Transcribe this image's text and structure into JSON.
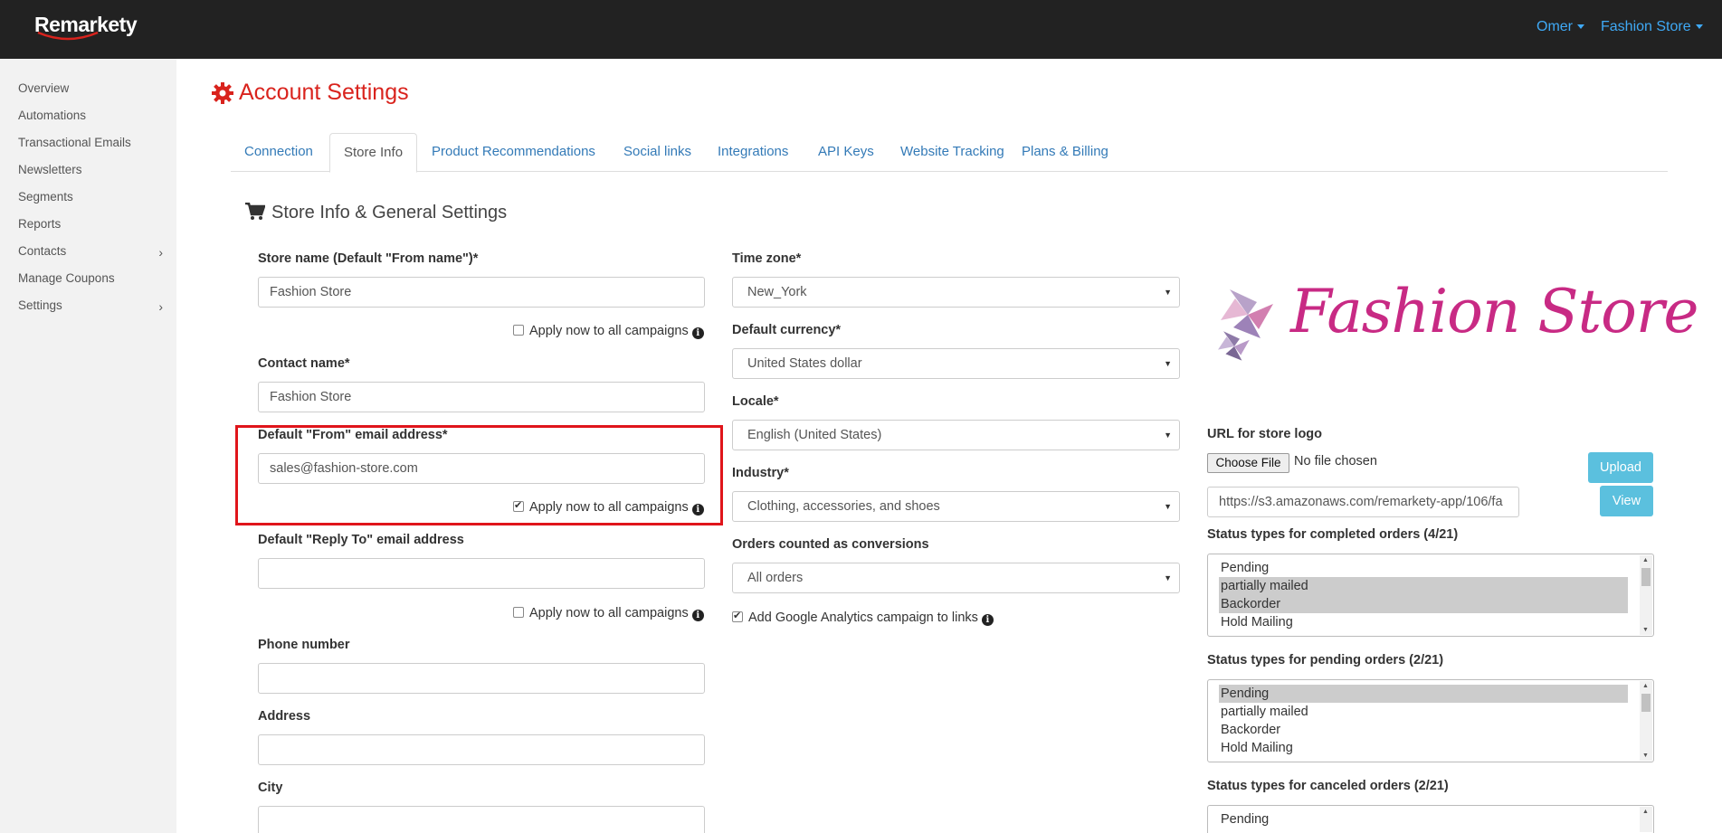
{
  "app": {
    "logo": "Remarkety"
  },
  "topnav": {
    "user": "Omer",
    "store": "Fashion Store"
  },
  "sidebar": {
    "items": [
      {
        "label": "Overview"
      },
      {
        "label": "Automations"
      },
      {
        "label": "Transactional Emails"
      },
      {
        "label": "Newsletters"
      },
      {
        "label": "Segments"
      },
      {
        "label": "Reports"
      },
      {
        "label": "Contacts",
        "has_submenu": true
      },
      {
        "label": "Manage Coupons"
      },
      {
        "label": "Settings",
        "has_submenu": true
      }
    ]
  },
  "page": {
    "title": "Account Settings"
  },
  "tabs": [
    {
      "label": "Connection"
    },
    {
      "label": "Store Info",
      "active": true
    },
    {
      "label": "Product Recommendations"
    },
    {
      "label": "Social links"
    },
    {
      "label": "Integrations"
    },
    {
      "label": "API Keys"
    },
    {
      "label": "Website Tracking"
    },
    {
      "label": "Plans & Billing"
    }
  ],
  "section": {
    "title": "Store Info & General Settings"
  },
  "left": {
    "store_name": {
      "label": "Store name (Default \"From name\")*",
      "value": "Fashion Store",
      "apply_checked": false
    },
    "contact_name": {
      "label": "Contact name*",
      "value": "Fashion Store"
    },
    "from_email": {
      "label": "Default \"From\" email address*",
      "value": "sales@fashion-store.com",
      "apply_checked": true
    },
    "reply_to": {
      "label": "Default \"Reply To\" email address",
      "value": "",
      "apply_checked": false
    },
    "phone": {
      "label": "Phone number",
      "value": ""
    },
    "address": {
      "label": "Address",
      "value": ""
    },
    "city": {
      "label": "City",
      "value": ""
    },
    "apply_label": "Apply now to all campaigns"
  },
  "middle": {
    "timezone": {
      "label": "Time zone*",
      "value": "New_York"
    },
    "currency": {
      "label": "Default currency*",
      "value": "United States dollar"
    },
    "locale": {
      "label": "Locale*",
      "value": "English (United States)"
    },
    "industry": {
      "label": "Industry*",
      "value": "Clothing, accessories, and shoes"
    },
    "conversions": {
      "label": "Orders counted as conversions",
      "value": "All orders"
    },
    "ga_checkbox": {
      "label": "Add Google Analytics campaign to links",
      "checked": true
    }
  },
  "right": {
    "logo_text": "Fashion Store",
    "logo_url_label": "URL for store logo",
    "choose_file": "Choose File",
    "no_file": "No file chosen",
    "upload_button": "Upload",
    "view_button": "View",
    "logo_url_value": "https://s3.amazonaws.com/remarkety-app/106/fa",
    "completed": {
      "label": "Status types for completed orders (4/21)",
      "options": [
        {
          "label": "Pending",
          "selected": false
        },
        {
          "label": "partially mailed",
          "selected": true
        },
        {
          "label": "Backorder",
          "selected": true
        },
        {
          "label": "Hold Mailing",
          "selected": false
        }
      ]
    },
    "pending": {
      "label": "Status types for pending orders (2/21)",
      "options": [
        {
          "label": "Pending",
          "selected": true
        },
        {
          "label": "partially mailed",
          "selected": false
        },
        {
          "label": "Backorder",
          "selected": false
        },
        {
          "label": "Hold Mailing",
          "selected": false
        }
      ]
    },
    "canceled": {
      "label": "Status types for canceled orders (2/21)",
      "options": [
        {
          "label": "Pending",
          "selected": false
        }
      ]
    }
  },
  "colors": {
    "accent_red": "#d9231d",
    "link_blue": "#337ab7",
    "topbar": "#222222",
    "info_button": "#5bc0de"
  }
}
